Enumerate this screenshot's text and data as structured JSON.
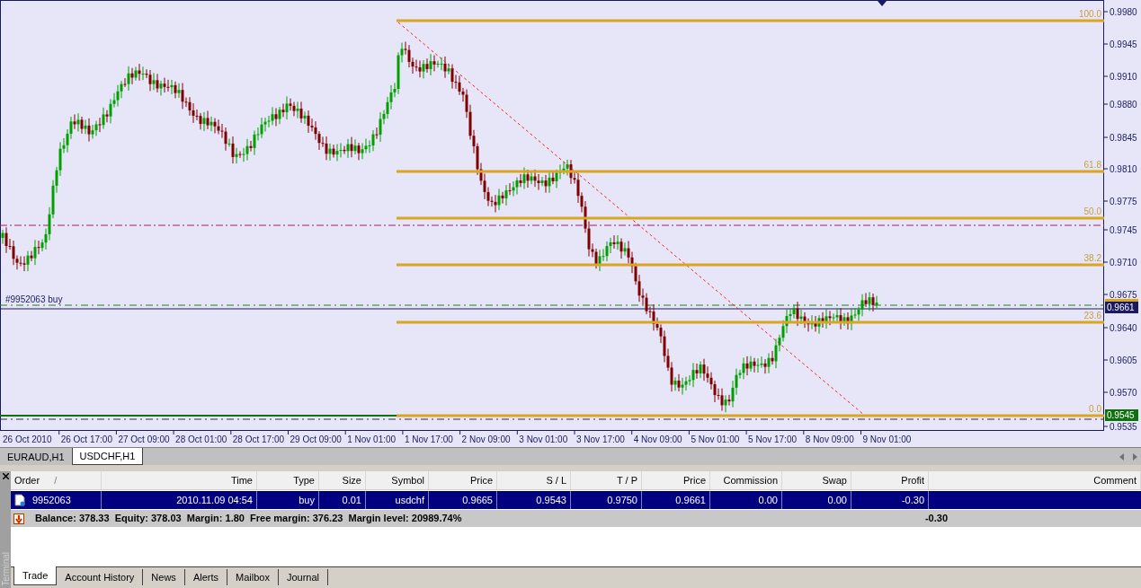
{
  "chart": {
    "price_axis": [
      "0.9980",
      "0.9945",
      "0.9910",
      "0.9880",
      "0.9845",
      "0.9810",
      "0.9775",
      "0.9745",
      "0.9710",
      "0.9675",
      "0.9640",
      "0.9605",
      "0.9570",
      "0.9535"
    ],
    "time_axis": [
      "26 Oct 2010",
      "26 Oct 17:00",
      "27 Oct 09:00",
      "28 Oct 01:00",
      "28 Oct 17:00",
      "29 Oct 09:00",
      "1 Nov 01:00",
      "1 Nov 17:00",
      "2 Nov 09:00",
      "3 Nov 01:00",
      "3 Nov 17:00",
      "4 Nov 09:00",
      "5 Nov 01:00",
      "5 Nov 17:00",
      "8 Nov 09:00",
      "9 Nov 01:00"
    ],
    "fib_levels": [
      {
        "label": "100.0"
      },
      {
        "label": "61.8"
      },
      {
        "label": "50.0"
      },
      {
        "label": "38.2"
      },
      {
        "label": "23.6"
      },
      {
        "label": "0.0"
      }
    ],
    "order_label": "#9952063 buy",
    "price_badges": [
      {
        "kind": "bid",
        "text": "0.9661"
      },
      {
        "kind": "low",
        "text": "0.9545"
      }
    ]
  },
  "chart_tabs": [
    {
      "label": "EURAUD,H1",
      "selected": false
    },
    {
      "label": "USDCHF,H1",
      "selected": true
    }
  ],
  "terminal": {
    "side_label": "Terminal",
    "columns": [
      {
        "label": "Order",
        "sort_mark": "/"
      },
      {
        "label": "Time"
      },
      {
        "label": "Type"
      },
      {
        "label": "Size"
      },
      {
        "label": "Symbol"
      },
      {
        "label": "Price"
      },
      {
        "label": "S / L"
      },
      {
        "label": "T / P"
      },
      {
        "label": "Price"
      },
      {
        "label": "Commission"
      },
      {
        "label": "Swap"
      },
      {
        "label": "Profit"
      },
      {
        "label": "Comment"
      }
    ],
    "rows": [
      {
        "selected": true,
        "cells": [
          "9952063",
          "2010.11.09 04:54",
          "buy",
          "0.01",
          "usdchf",
          "0.9665",
          "0.9543",
          "0.9750",
          "0.9661",
          "0.00",
          "0.00",
          "-0.30"
        ]
      }
    ],
    "summary": "Balance: 378.33  Equity: 378.03  Margin: 1.80  Free margin: 376.23  Margin level: 20989.74%",
    "summary_profit": "-0.30",
    "tabs": [
      {
        "label": "Trade",
        "selected": true
      },
      {
        "label": "Account History",
        "selected": false
      },
      {
        "label": "News",
        "selected": false
      },
      {
        "label": "Alerts",
        "selected": false
      },
      {
        "label": "Mailbox",
        "selected": false
      },
      {
        "label": "Journal",
        "selected": false
      }
    ]
  }
}
